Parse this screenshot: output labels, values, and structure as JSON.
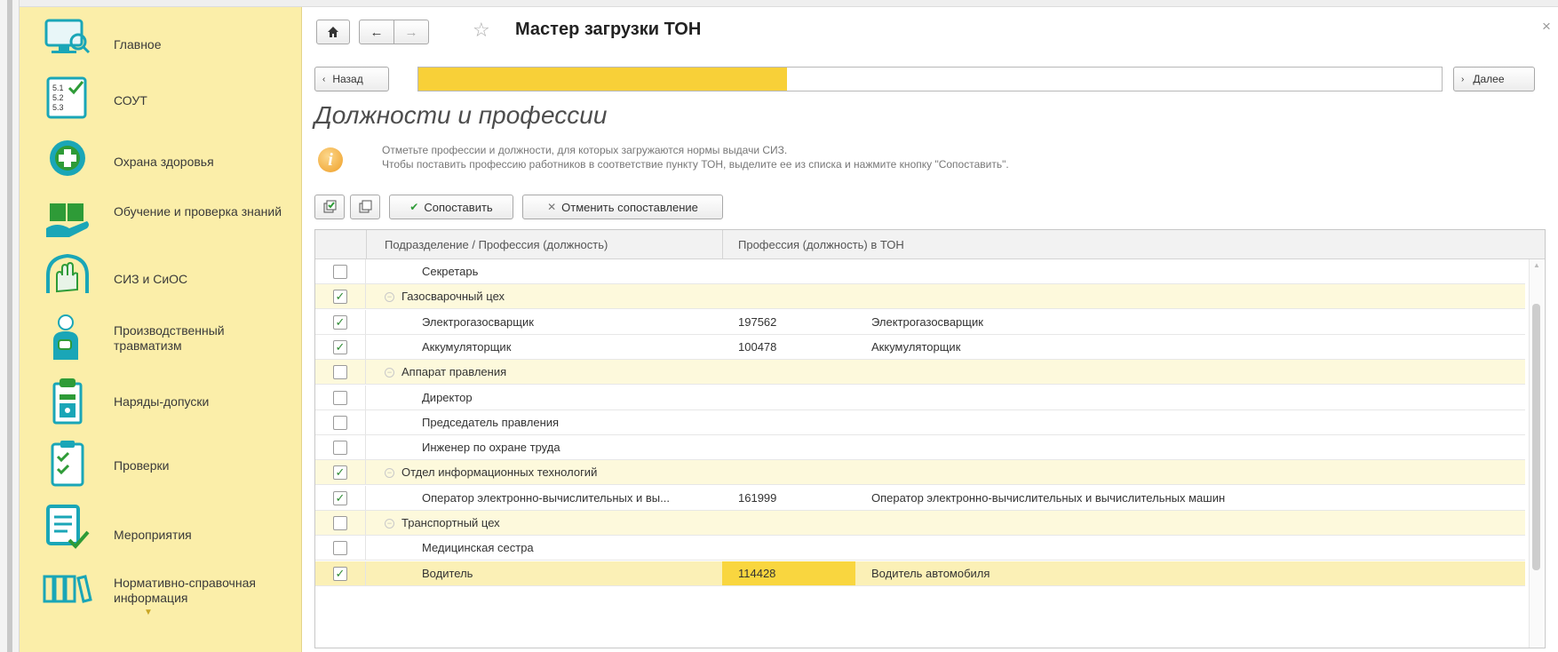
{
  "sidebar": {
    "items": [
      {
        "label": "Главное",
        "icon": "monitor-search-icon"
      },
      {
        "label": "СОУТ",
        "icon": "checklist-icon",
        "icon_text": [
          "5.1",
          "5.2",
          "5.3"
        ]
      },
      {
        "label": "Охрана здоровья",
        "icon": "medical-cross-icon"
      },
      {
        "label": "Обучение и проверка знаний",
        "icon": "book-hand-icon"
      },
      {
        "label": "СИЗ и СиОС",
        "icon": "gloves-icon"
      },
      {
        "label": "Производственный травматизм",
        "icon": "injured-person-icon"
      },
      {
        "label": "Наряды-допуски",
        "icon": "permit-icon"
      },
      {
        "label": "Проверки",
        "icon": "clipboard-check-icon"
      },
      {
        "label": "Мероприятия",
        "icon": "list-check-icon"
      },
      {
        "label": "Нормативно-справочная информация",
        "icon": "books-icon"
      }
    ]
  },
  "header": {
    "title": "Мастер загрузки ТОН",
    "home_icon": "home-icon",
    "back_icon": "arrow-left-icon",
    "forward_icon": "arrow-right-icon",
    "favorite_icon": "star-icon",
    "close_glyph": "×"
  },
  "wizard": {
    "back_label": "Назад",
    "next_label": "Далее",
    "progress_fraction": 0.36
  },
  "page": {
    "heading": "Должности и профессии",
    "info_line1": "Отметьте профессии и должности, для которых загружаются нормы выдачи СИЗ.",
    "info_line2": "Чтобы поставить профессию работников в соответствие пункту ТОН, выделите ее из списка и нажмите кнопку \"Сопоставить\"."
  },
  "toolbar": {
    "match_label": "Сопоставить",
    "unmatch_label": "Отменить сопоставление"
  },
  "table": {
    "columns": [
      "Подразделение / Профессия (должность)",
      "Профессия (должность) в ТОН"
    ],
    "rows": [
      {
        "type": "item",
        "checked": false,
        "name": "Секретарь",
        "code": "",
        "ton_name": ""
      },
      {
        "type": "group",
        "checked": true,
        "name": "Газосварочный цех",
        "code": "",
        "ton_name": ""
      },
      {
        "type": "item",
        "checked": true,
        "name": "Электрогазосварщик",
        "code": "197562",
        "ton_name": "Электрогазосварщик"
      },
      {
        "type": "item",
        "checked": true,
        "name": "Аккумуляторщик",
        "code": "100478",
        "ton_name": "Аккумуляторщик"
      },
      {
        "type": "group",
        "checked": false,
        "name": "Аппарат правления",
        "code": "",
        "ton_name": ""
      },
      {
        "type": "item",
        "checked": false,
        "name": "Директор",
        "code": "",
        "ton_name": ""
      },
      {
        "type": "item",
        "checked": false,
        "name": "Председатель правления",
        "code": "",
        "ton_name": ""
      },
      {
        "type": "item",
        "checked": false,
        "name": "Инженер по охране труда",
        "code": "",
        "ton_name": ""
      },
      {
        "type": "group",
        "checked": true,
        "name": "Отдел информационных технологий",
        "code": "",
        "ton_name": ""
      },
      {
        "type": "item",
        "checked": true,
        "name": "Оператор электронно-вычислительных и вы...",
        "code": "161999",
        "ton_name": "Оператор электронно-вычислительных и вычислительных машин"
      },
      {
        "type": "group",
        "checked": false,
        "name": "Транспортный цех",
        "code": "",
        "ton_name": ""
      },
      {
        "type": "item",
        "checked": false,
        "name": "Медицинская сестра",
        "code": "",
        "ton_name": ""
      },
      {
        "type": "item",
        "checked": true,
        "name": "Водитель",
        "code": "114428",
        "ton_name": "Водитель автомобиля",
        "selected": true
      }
    ]
  }
}
